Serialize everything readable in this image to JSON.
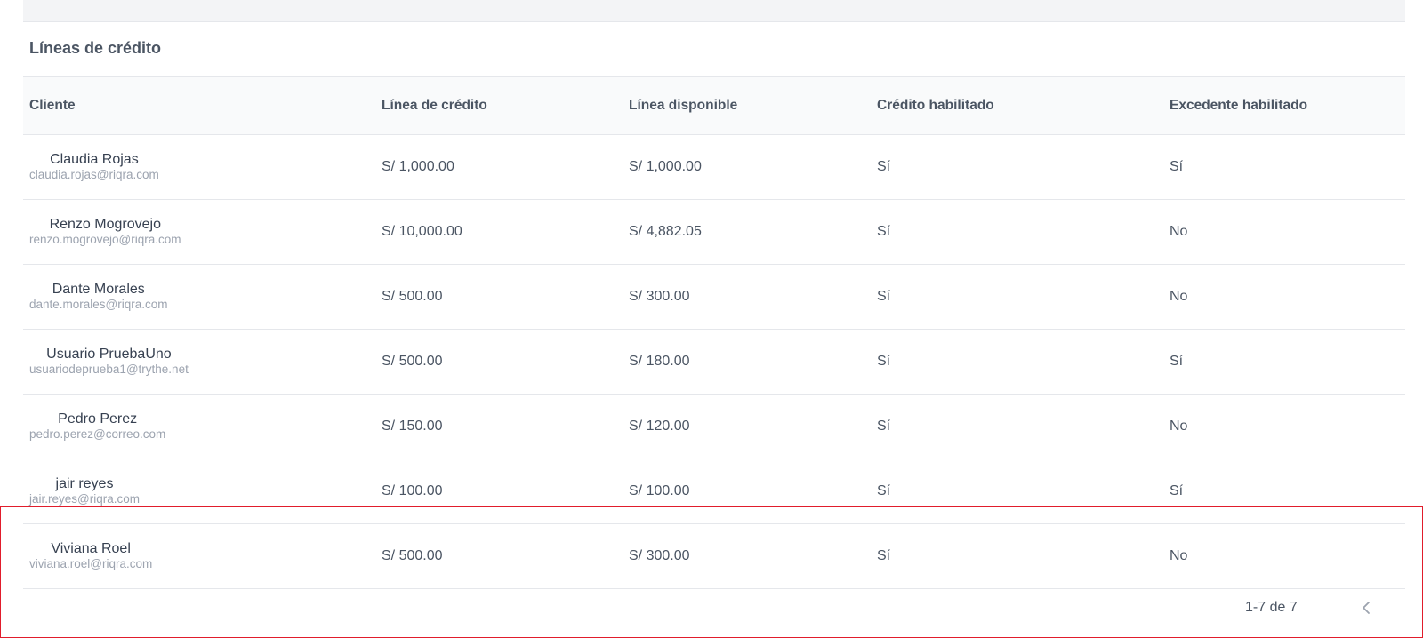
{
  "section": {
    "title": "Líneas de crédito"
  },
  "table": {
    "headers": [
      "Cliente",
      "Línea de crédito",
      "Línea disponible",
      "Crédito habilitado",
      "Excedente habilitado"
    ],
    "rows": [
      {
        "name": "Claudia Rojas",
        "email": "claudia.rojas@riqra.com",
        "credit_line": "S/ 1,000.00",
        "available": "S/ 1,000.00",
        "credit_enabled": "Sí",
        "excess_enabled": "Sí"
      },
      {
        "name": "Renzo Mogrovejo",
        "email": "renzo.mogrovejo@riqra.com",
        "credit_line": "S/ 10,000.00",
        "available": "S/ 4,882.05",
        "credit_enabled": "Sí",
        "excess_enabled": "No"
      },
      {
        "name": "Dante Morales",
        "email": "dante.morales@riqra.com",
        "credit_line": "S/ 500.00",
        "available": "S/ 300.00",
        "credit_enabled": "Sí",
        "excess_enabled": "No"
      },
      {
        "name": "Usuario PruebaUno",
        "email": "usuariodeprueba1@trythe.net",
        "credit_line": "S/ 500.00",
        "available": "S/ 180.00",
        "credit_enabled": "Sí",
        "excess_enabled": "Sí"
      },
      {
        "name": "Pedro Perez",
        "email": "pedro.perez@correo.com",
        "credit_line": "S/ 150.00",
        "available": "S/ 120.00",
        "credit_enabled": "Sí",
        "excess_enabled": "No"
      },
      {
        "name": "jair reyes",
        "email": "jair.reyes@riqra.com",
        "credit_line": "S/ 100.00",
        "available": "S/ 100.00",
        "credit_enabled": "Sí",
        "excess_enabled": "Sí"
      },
      {
        "name": "Viviana Roel",
        "email": "viviana.roel@riqra.com",
        "credit_line": "S/ 500.00",
        "available": "S/ 300.00",
        "credit_enabled": "Sí",
        "excess_enabled": "No"
      }
    ]
  },
  "pagination": {
    "range_text": "1-7 de 7",
    "prev_icon": "chevron-left-icon"
  },
  "colors": {
    "highlight": "#e11d2c",
    "header_bg": "#f9fafb",
    "border": "#e5e7eb"
  }
}
